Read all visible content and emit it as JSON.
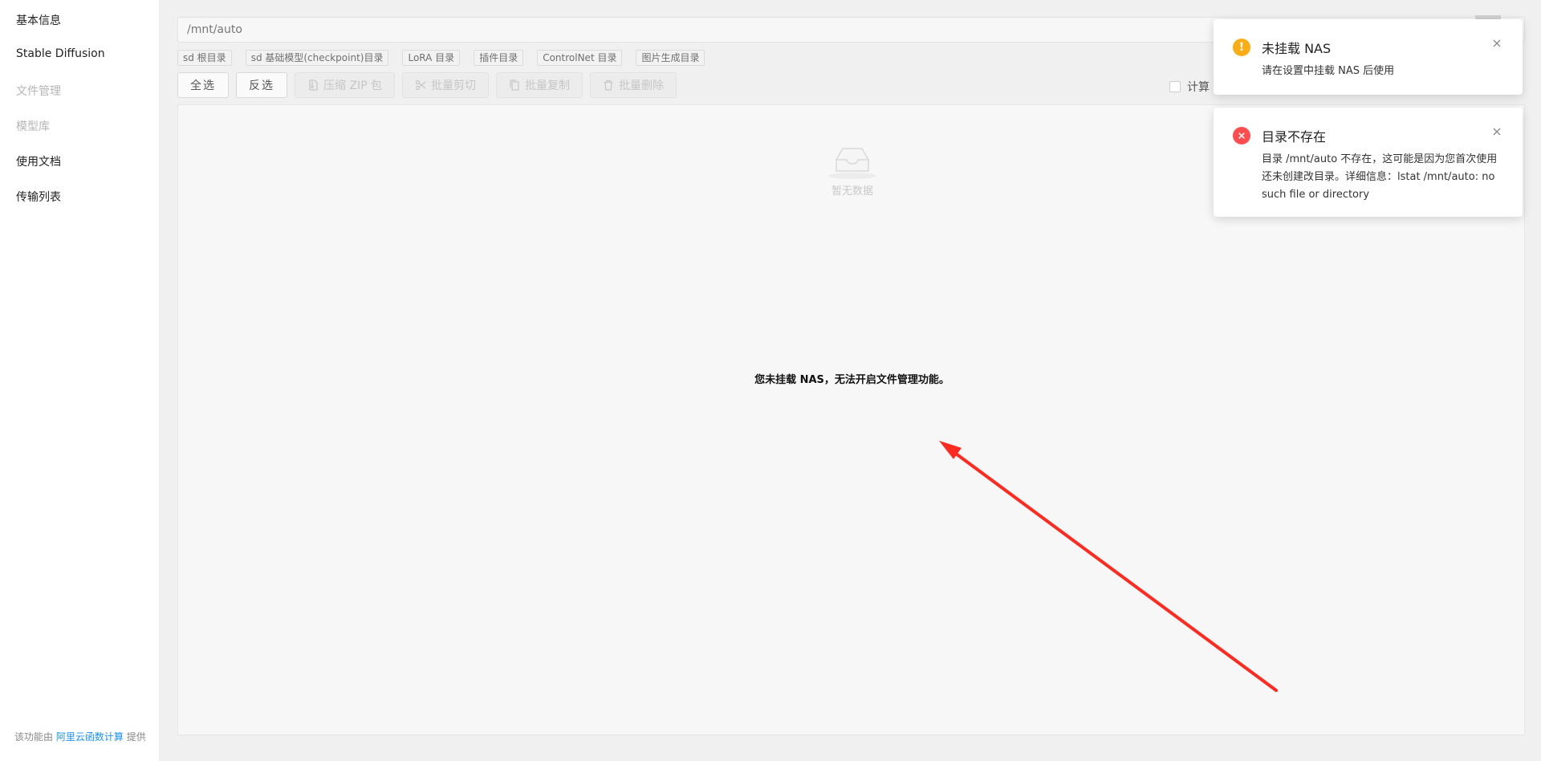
{
  "sidebar": {
    "items": [
      {
        "label": "基本信息",
        "disabled": false
      },
      {
        "label": "Stable Diffusion",
        "disabled": false
      },
      {
        "label": "文件管理",
        "disabled": true
      },
      {
        "label": "模型库",
        "disabled": true
      },
      {
        "label": "使用文档",
        "disabled": false
      },
      {
        "label": "传输列表",
        "disabled": false
      }
    ],
    "footer": {
      "prefix": "该功能由",
      "link": "阿里云函数计算",
      "suffix": "提供"
    }
  },
  "path": {
    "value": "/mnt/auto"
  },
  "tags": [
    "sd 根目录",
    "sd 基础模型(checkpoint)目录",
    "LoRA 目录",
    "插件目录",
    "ControlNet 目录",
    "图片生成目录"
  ],
  "toolbar": {
    "select_all": "全选",
    "invert": "反选",
    "zip": "压缩 ZIP 包",
    "cut": "批量剪切",
    "copy": "批量复制",
    "delete": "批量删除",
    "calc_label": "计算"
  },
  "content": {
    "empty_text": "暂无数据",
    "message": "您未挂载 NAS，无法开启文件管理功能。"
  },
  "notifications": [
    {
      "type": "warning",
      "title": "未挂载 NAS",
      "body": "请在设置中挂载 NAS 后使用"
    },
    {
      "type": "error",
      "title": "目录不存在",
      "body": "目录 /mnt/auto 不存在，这可能是因为您首次使用还未创建改目录。详细信息：lstat /mnt/auto: no such file or directory"
    }
  ],
  "colors": {
    "warning": "#faad14",
    "error": "#ff4d4f",
    "link": "#1890ff",
    "arrow": "#ff2a1f"
  },
  "icons": {
    "warning": "exclamation-circle",
    "error": "close-circle",
    "close": "close",
    "zip": "file-zip",
    "cut": "scissor",
    "copy": "copy",
    "delete": "delete",
    "empty": "inbox"
  }
}
